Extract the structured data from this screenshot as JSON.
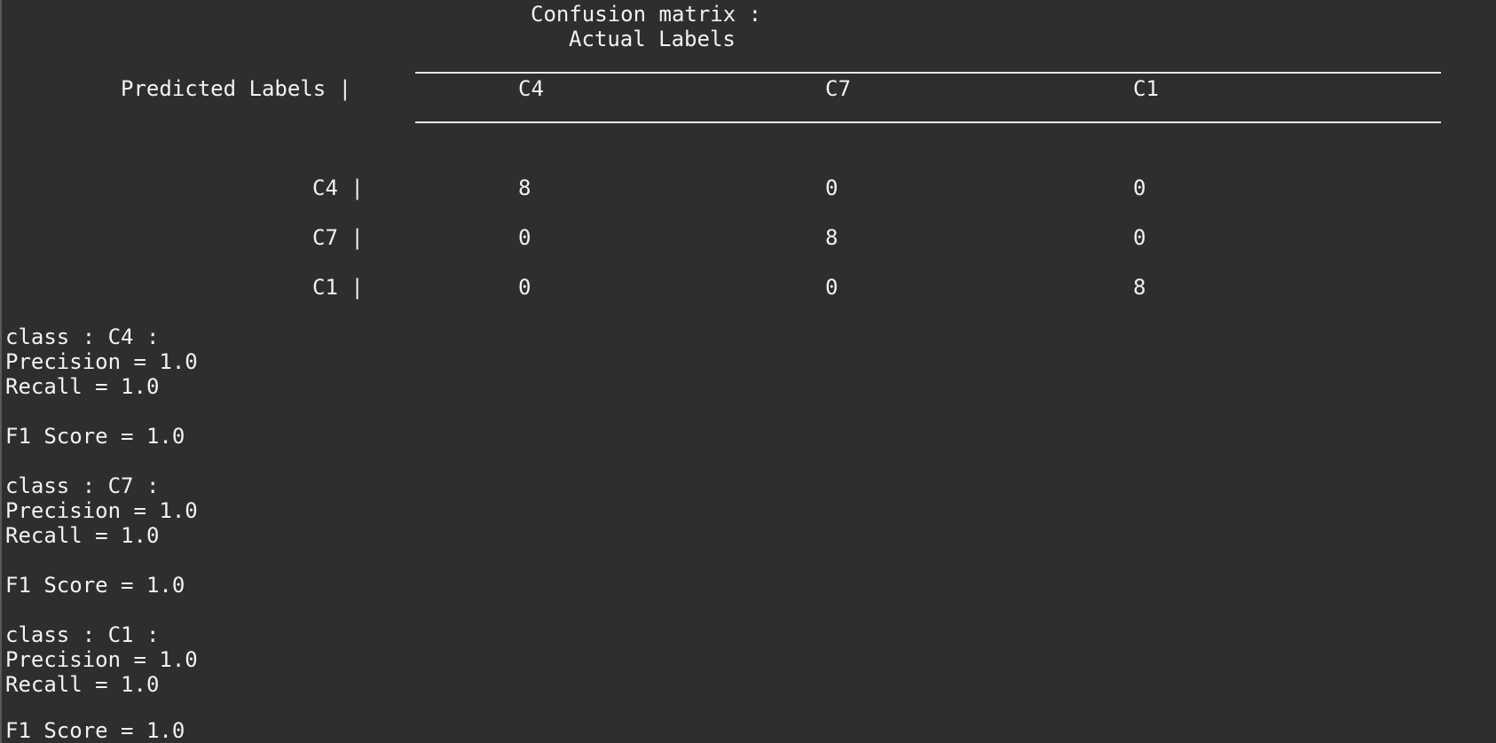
{
  "header": {
    "title": "Confusion matrix :",
    "actual_label": "Actual Labels",
    "predicted_label": "Predicted Labels |"
  },
  "matrix": {
    "columns": [
      "C4",
      "C7",
      "C1"
    ],
    "rows": [
      {
        "label": "C4 |",
        "values": [
          "8",
          "0",
          "0"
        ]
      },
      {
        "label": "C7 |",
        "values": [
          "0",
          "8",
          "0"
        ]
      },
      {
        "label": "C1 |",
        "values": [
          "0",
          "0",
          "8"
        ]
      }
    ]
  },
  "metrics": [
    {
      "class_line": "class : C4 :",
      "precision": "Precision = 1.0",
      "recall": "Recall = 1.0",
      "f1": "F1 Score = 1.0"
    },
    {
      "class_line": "class : C7 :",
      "precision": "Precision = 1.0",
      "recall": "Recall = 1.0",
      "f1": "F1 Score = 1.0"
    },
    {
      "class_line": "class : C1 :",
      "precision": "Precision = 1.0",
      "recall": "Recall = 1.0",
      "f1": "F1 Score = 1.0"
    }
  ],
  "colors": {
    "background": "#2e2e2e",
    "text": "#f2f2f2"
  }
}
